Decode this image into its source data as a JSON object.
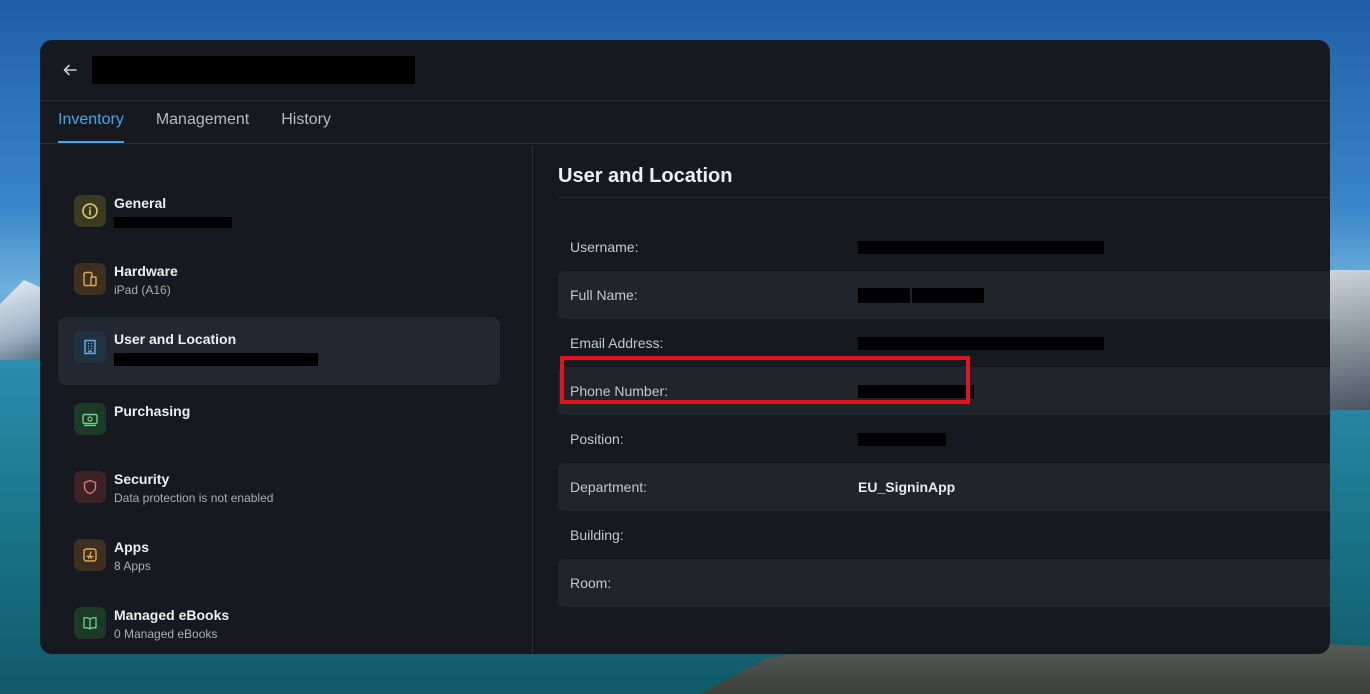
{
  "tabs": [
    {
      "label": "Inventory",
      "active": true
    },
    {
      "label": "Management",
      "active": false
    },
    {
      "label": "History",
      "active": false
    }
  ],
  "sidebar": {
    "items": [
      {
        "title": "General",
        "subtitle": "",
        "icon": "info-icon",
        "color": "#3a3a22",
        "icon_color": "#e3d26b"
      },
      {
        "title": "Hardware",
        "subtitle": "iPad (A16)",
        "icon": "devices-icon",
        "color": "#3d3020",
        "icon_color": "#e2a95a"
      },
      {
        "title": "User and Location",
        "subtitle": "",
        "icon": "building-icon",
        "color": "#1f3344",
        "icon_color": "#6fb0e3"
      },
      {
        "title": "Purchasing",
        "subtitle": "",
        "icon": "money-icon",
        "color": "#1d3a28",
        "icon_color": "#6bd08a"
      },
      {
        "title": "Security",
        "subtitle": "Data protection is not enabled",
        "icon": "shield-icon",
        "color": "#3d2326",
        "icon_color": "#e07a80"
      },
      {
        "title": "Apps",
        "subtitle": "8 Apps",
        "icon": "app-store-icon",
        "color": "#3d3020",
        "icon_color": "#e2a95a"
      },
      {
        "title": "Managed eBooks",
        "subtitle": "0 Managed eBooks",
        "icon": "book-icon",
        "color": "#1d3a28",
        "icon_color": "#6bd08a"
      }
    ]
  },
  "main": {
    "section_title": "User and Location",
    "fields": [
      {
        "label": "Username:",
        "value": ""
      },
      {
        "label": "Full Name:",
        "value": ""
      },
      {
        "label": "Email Address:",
        "value": ""
      },
      {
        "label": "Phone Number:",
        "value": ""
      },
      {
        "label": "Position:",
        "value": ""
      },
      {
        "label": "Department:",
        "value": "EU_SigninApp"
      },
      {
        "label": "Building:",
        "value": ""
      },
      {
        "label": "Room:",
        "value": ""
      }
    ]
  },
  "colors": {
    "accent": "#4aa3e6",
    "highlight": "#e3141d"
  }
}
